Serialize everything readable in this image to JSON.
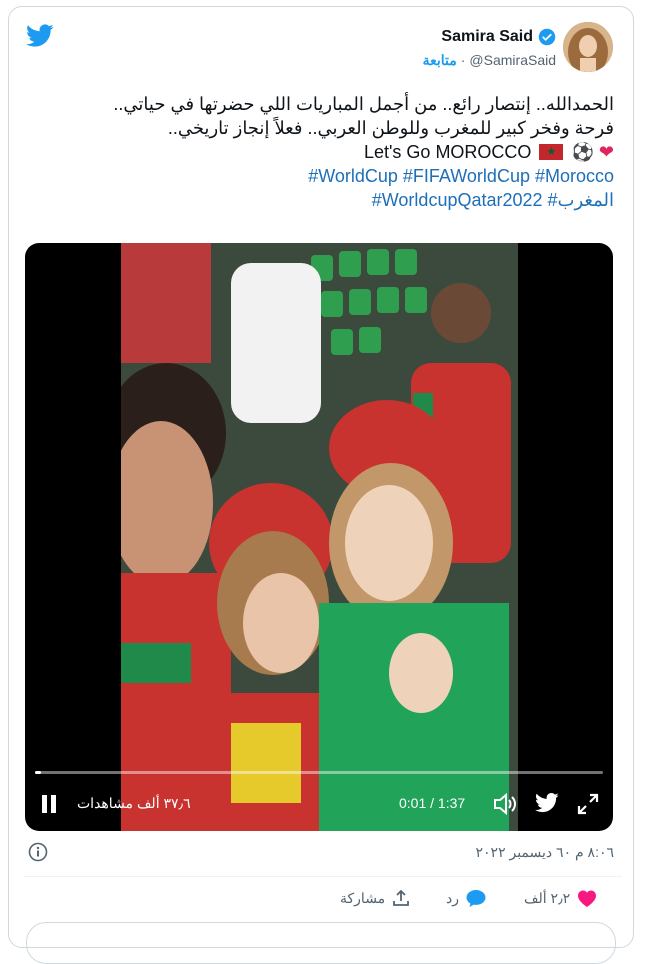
{
  "user": {
    "name": "Samira Said",
    "handle": "@SamiraSaid",
    "separator": "·",
    "follow_label": "متابعة"
  },
  "tweet": {
    "lines": [
      "الحمدالله.. إنتصار رائع.. من أجمل المباريات اللي حضرتها في حياتي..",
      "فرحة وفخر كبير للمغرب وللوطن العربي.. فعلاً إنجاز تاريخي..",
      "Let's Go MOROCCO"
    ],
    "hashtags_line1": "#WorldCup #FIFAWorldCup #Morocco",
    "hashtags_line2": "#WorldcupQatar2022 #المغرب"
  },
  "video": {
    "time": "0:01 / 1:37",
    "views": "٣٧٫٦ ألف مشاهدات",
    "progress_fraction": 0.01
  },
  "timestamp": "٨:٠٦ م ٦٠ ديسمبر ٢٠٢٢",
  "actions": {
    "likes": "٢٫٢ ألف",
    "reply_label": "رد",
    "share_label": "مشاركة"
  },
  "colors": {
    "accent": "#1d9bf0",
    "like": "#f91880",
    "hashtag": "#1d6fb8"
  },
  "icons": [
    "twitter-bird-icon",
    "verified-badge-icon",
    "pause-icon",
    "volume-icon",
    "twitter-icon",
    "fullscreen-icon",
    "info-icon",
    "heart-icon",
    "reply-bubble-icon",
    "share-icon"
  ]
}
